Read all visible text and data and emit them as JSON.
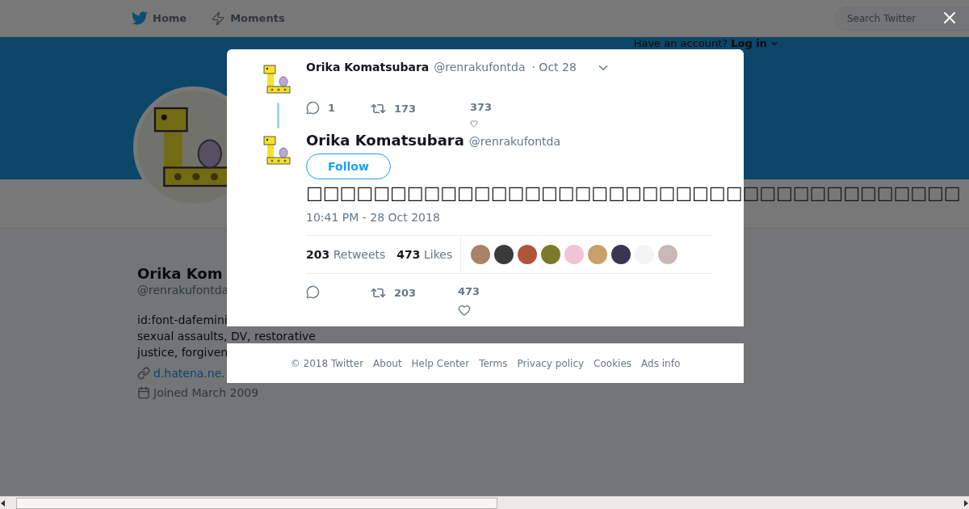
{
  "nav": {
    "items": [
      {
        "label": "Home"
      },
      {
        "label": "Moments"
      }
    ],
    "search": {
      "placeholder": "Search Twitter"
    },
    "login": {
      "prompt": "Have an account?",
      "link": "Log in"
    }
  },
  "profile": {
    "name": "Orika Kom",
    "handle": "@renrakufontda",
    "bio": [
      "id:font-dafemini",
      "sexual assaults, DV, restorative",
      "justice, forgiven"
    ],
    "link": "d.hatena.ne.",
    "joined": "Joined March 2009"
  },
  "parent_tweet": {
    "name": "Orika Komatsubara",
    "handle": "@renrakufontda",
    "date": "· Oct 28",
    "replies": "1",
    "retweets": "173",
    "likes": "373"
  },
  "tweet": {
    "name": "Orika Komatsubara",
    "handle": "@renrakufontda",
    "follow": "Follow",
    "text": "□□□□□□□□□□□□□□□□□□□□□□□□□□□□□□□□□□□□□□□",
    "time": "10:41 PM - 28 Oct 2018",
    "retweet_count": "203",
    "retweet_label": "Retweets",
    "like_count": "473",
    "like_label": "Likes",
    "retweets": "203",
    "likes": "473"
  },
  "footer": [
    "© 2018 Twitter",
    "About",
    "Help Center",
    "Terms",
    "Privacy policy",
    "Cookies",
    "Ads info"
  ]
}
